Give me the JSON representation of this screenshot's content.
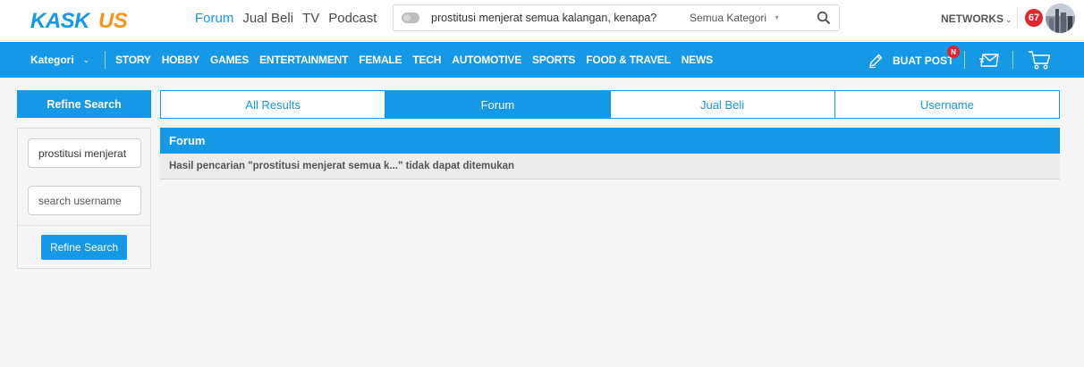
{
  "header": {
    "logo_text": "KASKUS",
    "nav": [
      {
        "label": "Forum",
        "active": true
      },
      {
        "label": "Jual Beli",
        "active": false
      },
      {
        "label": "TV",
        "active": false
      },
      {
        "label": "Podcast",
        "active": false
      }
    ],
    "search": {
      "value": "prostitusi menjerat semua kalangan, kenapa?",
      "category": "Semua Kategori"
    },
    "networks_label": "NETWORKS",
    "notification_count": "67"
  },
  "catbar": {
    "dropdown_label": "Kategori",
    "links": [
      "STORY",
      "HOBBY",
      "GAMES",
      "ENTERTAINMENT",
      "FEMALE",
      "TECH",
      "AUTOMOTIVE",
      "SPORTS",
      "FOOD & TRAVEL",
      "NEWS"
    ],
    "create_post_label": "BUAT POST",
    "create_post_badge": "N"
  },
  "sidebar": {
    "title": "Refine Search",
    "keyword_value": "prostitusi menjerat",
    "username_placeholder": "search username",
    "button_label": "Refine Search"
  },
  "tabs": [
    {
      "label": "All Results",
      "active": false
    },
    {
      "label": "Forum",
      "active": true
    },
    {
      "label": "Jual Beli",
      "active": false
    },
    {
      "label": "Username",
      "active": false
    }
  ],
  "results": {
    "section_title": "Forum",
    "message": "Hasil pencarian \"prostitusi menjerat semua k...\" tidak dapat ditemukan"
  },
  "colors": {
    "brand_blue": "#1598e5",
    "logo_orange": "#f7941d",
    "badge_red": "#e3242b"
  }
}
